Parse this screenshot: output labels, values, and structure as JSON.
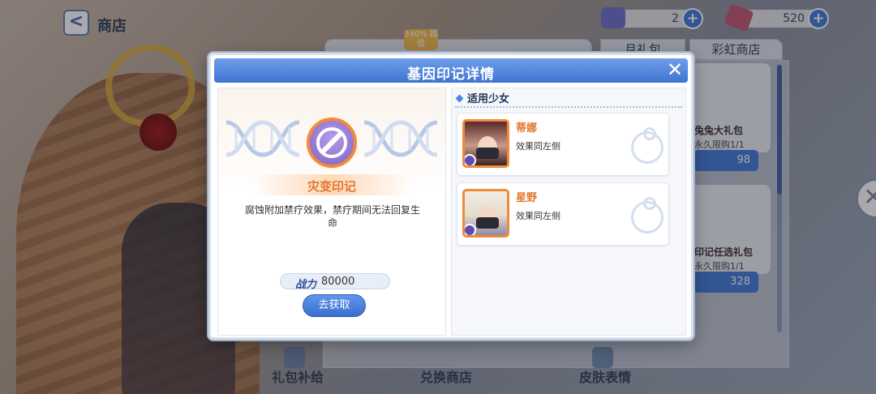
{
  "header": {
    "back_label": "<",
    "title": "商店"
  },
  "currencies": [
    {
      "icon": "ticket-icon",
      "value": "2",
      "plus": "+"
    },
    {
      "icon": "crystal-icon",
      "value": "520",
      "plus": "+"
    }
  ],
  "shop": {
    "sale_badge": "340% 超值",
    "tabs": [
      "月礼包",
      "彩虹商店"
    ],
    "cards": [
      {
        "title": "兔兔大礼包",
        "limit": "永久限购1/1",
        "price": "98"
      },
      {
        "title": "印记任选礼包",
        "limit": "永久限购1/1",
        "price": "328"
      }
    ],
    "bottom_tabs": [
      "礼包补给",
      "兑换商店",
      "皮肤表情"
    ]
  },
  "modal": {
    "title": "基因印记详情",
    "close_label": "✕",
    "mark": {
      "name": "灾变印记",
      "description": "腐蚀附加禁疗效果，禁疗期间无法回复生命",
      "power_label": "战力",
      "power_value": "80000",
      "get_button": "去获取"
    },
    "applicable": {
      "header": "适用少女",
      "girls": [
        {
          "name": "蒂娜",
          "effect": "效果同左侧"
        },
        {
          "name": "星野",
          "effect": "效果同左侧"
        }
      ]
    }
  },
  "colors": {
    "header_blue": "#3f74d2",
    "accent_orange": "#e2772e",
    "button_blue": "#3a6fd0"
  }
}
